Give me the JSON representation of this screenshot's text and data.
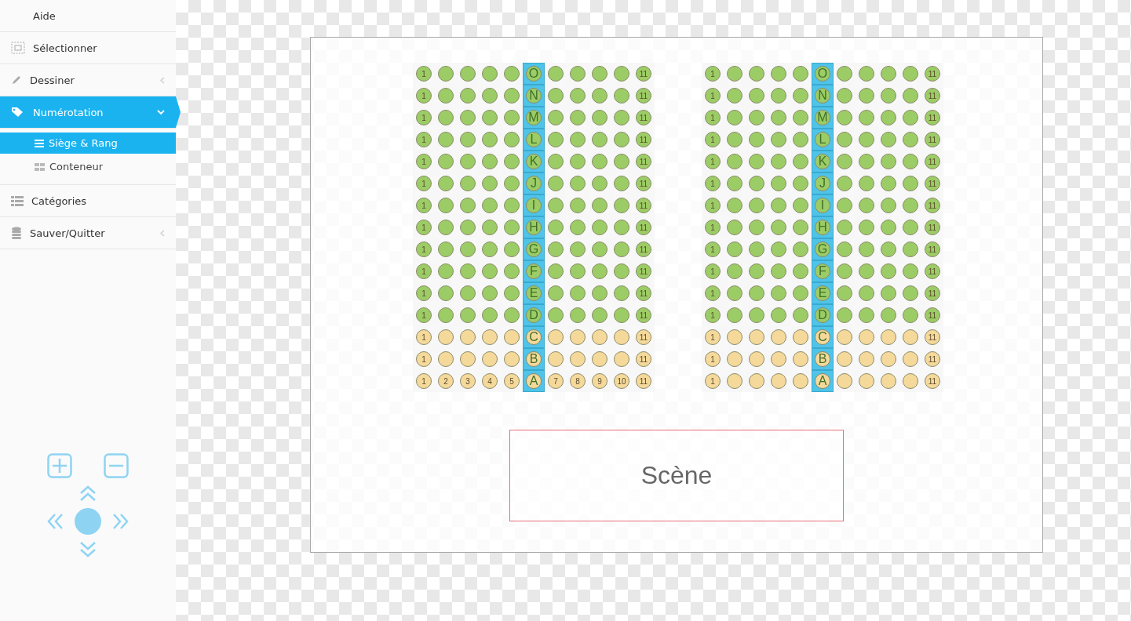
{
  "sidebar": {
    "items": [
      {
        "label": "Aide",
        "selected": false
      },
      {
        "label": "Sélectionner",
        "selected": false
      },
      {
        "label": "Dessiner",
        "selected": false,
        "expanded": false
      },
      {
        "label": "Numérotation",
        "selected": true,
        "expanded": true,
        "children": [
          {
            "label": "Siège & Rang",
            "selected": true
          },
          {
            "label": "Conteneur",
            "selected": false
          }
        ]
      },
      {
        "label": "Catégories",
        "selected": false
      },
      {
        "label": "Sauver/Quitter",
        "selected": false,
        "expanded": false
      }
    ]
  },
  "blocks": [
    {
      "rows": [
        {
          "color": "#9ccc65",
          "seats": [
            {
              "kind": "number",
              "label": "1"
            },
            {
              "kind": "blank"
            },
            {
              "kind": "blank"
            },
            {
              "kind": "blank"
            },
            {
              "kind": "blank"
            },
            {
              "kind": "row",
              "label": "O"
            },
            {
              "kind": "blank"
            },
            {
              "kind": "blank"
            },
            {
              "kind": "blank"
            },
            {
              "kind": "blank"
            },
            {
              "kind": "number",
              "label": "11"
            }
          ]
        },
        {
          "color": "#9ccc65",
          "seats": [
            {
              "kind": "number",
              "label": "1"
            },
            {
              "kind": "blank"
            },
            {
              "kind": "blank"
            },
            {
              "kind": "blank"
            },
            {
              "kind": "blank"
            },
            {
              "kind": "row",
              "label": "N"
            },
            {
              "kind": "blank"
            },
            {
              "kind": "blank"
            },
            {
              "kind": "blank"
            },
            {
              "kind": "blank"
            },
            {
              "kind": "number",
              "label": "11"
            }
          ]
        },
        {
          "color": "#9ccc65",
          "seats": [
            {
              "kind": "number",
              "label": "1"
            },
            {
              "kind": "blank"
            },
            {
              "kind": "blank"
            },
            {
              "kind": "blank"
            },
            {
              "kind": "blank"
            },
            {
              "kind": "row",
              "label": "M"
            },
            {
              "kind": "blank"
            },
            {
              "kind": "blank"
            },
            {
              "kind": "blank"
            },
            {
              "kind": "blank"
            },
            {
              "kind": "number",
              "label": "11"
            }
          ]
        },
        {
          "color": "#9ccc65",
          "seats": [
            {
              "kind": "number",
              "label": "1"
            },
            {
              "kind": "blank"
            },
            {
              "kind": "blank"
            },
            {
              "kind": "blank"
            },
            {
              "kind": "blank"
            },
            {
              "kind": "row",
              "label": "L"
            },
            {
              "kind": "blank"
            },
            {
              "kind": "blank"
            },
            {
              "kind": "blank"
            },
            {
              "kind": "blank"
            },
            {
              "kind": "number",
              "label": "11"
            }
          ]
        },
        {
          "color": "#9ccc65",
          "seats": [
            {
              "kind": "number",
              "label": "1"
            },
            {
              "kind": "blank"
            },
            {
              "kind": "blank"
            },
            {
              "kind": "blank"
            },
            {
              "kind": "blank"
            },
            {
              "kind": "row",
              "label": "K"
            },
            {
              "kind": "blank"
            },
            {
              "kind": "blank"
            },
            {
              "kind": "blank"
            },
            {
              "kind": "blank"
            },
            {
              "kind": "number",
              "label": "11"
            }
          ]
        },
        {
          "color": "#9ccc65",
          "seats": [
            {
              "kind": "number",
              "label": "1"
            },
            {
              "kind": "blank"
            },
            {
              "kind": "blank"
            },
            {
              "kind": "blank"
            },
            {
              "kind": "blank"
            },
            {
              "kind": "row",
              "label": "J"
            },
            {
              "kind": "blank"
            },
            {
              "kind": "blank"
            },
            {
              "kind": "blank"
            },
            {
              "kind": "blank"
            },
            {
              "kind": "number",
              "label": "11"
            }
          ]
        },
        {
          "color": "#9ccc65",
          "seats": [
            {
              "kind": "number",
              "label": "1"
            },
            {
              "kind": "blank"
            },
            {
              "kind": "blank"
            },
            {
              "kind": "blank"
            },
            {
              "kind": "blank"
            },
            {
              "kind": "row",
              "label": "I"
            },
            {
              "kind": "blank"
            },
            {
              "kind": "blank"
            },
            {
              "kind": "blank"
            },
            {
              "kind": "blank"
            },
            {
              "kind": "number",
              "label": "11"
            }
          ]
        },
        {
          "color": "#9ccc65",
          "seats": [
            {
              "kind": "number",
              "label": "1"
            },
            {
              "kind": "blank"
            },
            {
              "kind": "blank"
            },
            {
              "kind": "blank"
            },
            {
              "kind": "blank"
            },
            {
              "kind": "row",
              "label": "H"
            },
            {
              "kind": "blank"
            },
            {
              "kind": "blank"
            },
            {
              "kind": "blank"
            },
            {
              "kind": "blank"
            },
            {
              "kind": "number",
              "label": "11"
            }
          ]
        },
        {
          "color": "#9ccc65",
          "seats": [
            {
              "kind": "number",
              "label": "1"
            },
            {
              "kind": "blank"
            },
            {
              "kind": "blank"
            },
            {
              "kind": "blank"
            },
            {
              "kind": "blank"
            },
            {
              "kind": "row",
              "label": "G"
            },
            {
              "kind": "blank"
            },
            {
              "kind": "blank"
            },
            {
              "kind": "blank"
            },
            {
              "kind": "blank"
            },
            {
              "kind": "number",
              "label": "11"
            }
          ]
        },
        {
          "color": "#9ccc65",
          "seats": [
            {
              "kind": "number",
              "label": "1"
            },
            {
              "kind": "blank"
            },
            {
              "kind": "blank"
            },
            {
              "kind": "blank"
            },
            {
              "kind": "blank"
            },
            {
              "kind": "row",
              "label": "F"
            },
            {
              "kind": "blank"
            },
            {
              "kind": "blank"
            },
            {
              "kind": "blank"
            },
            {
              "kind": "blank"
            },
            {
              "kind": "number",
              "label": "11"
            }
          ]
        },
        {
          "color": "#9ccc65",
          "seats": [
            {
              "kind": "number",
              "label": "1"
            },
            {
              "kind": "blank"
            },
            {
              "kind": "blank"
            },
            {
              "kind": "blank"
            },
            {
              "kind": "blank"
            },
            {
              "kind": "row",
              "label": "E"
            },
            {
              "kind": "blank"
            },
            {
              "kind": "blank"
            },
            {
              "kind": "blank"
            },
            {
              "kind": "blank"
            },
            {
              "kind": "number",
              "label": "11"
            }
          ]
        },
        {
          "color": "#9ccc65",
          "seats": [
            {
              "kind": "number",
              "label": "1"
            },
            {
              "kind": "blank"
            },
            {
              "kind": "blank"
            },
            {
              "kind": "blank"
            },
            {
              "kind": "blank"
            },
            {
              "kind": "row",
              "label": "D"
            },
            {
              "kind": "blank"
            },
            {
              "kind": "blank"
            },
            {
              "kind": "blank"
            },
            {
              "kind": "blank"
            },
            {
              "kind": "number",
              "label": "11"
            }
          ]
        },
        {
          "color": "#f5d99a",
          "seats": [
            {
              "kind": "number",
              "label": "1"
            },
            {
              "kind": "blank"
            },
            {
              "kind": "blank"
            },
            {
              "kind": "blank"
            },
            {
              "kind": "blank"
            },
            {
              "kind": "row",
              "label": "C"
            },
            {
              "kind": "blank"
            },
            {
              "kind": "blank"
            },
            {
              "kind": "blank"
            },
            {
              "kind": "blank"
            },
            {
              "kind": "number",
              "label": "11"
            }
          ]
        },
        {
          "color": "#f5d99a",
          "seats": [
            {
              "kind": "number",
              "label": "1"
            },
            {
              "kind": "blank"
            },
            {
              "kind": "blank"
            },
            {
              "kind": "blank"
            },
            {
              "kind": "blank"
            },
            {
              "kind": "row",
              "label": "B"
            },
            {
              "kind": "blank"
            },
            {
              "kind": "blank"
            },
            {
              "kind": "blank"
            },
            {
              "kind": "blank"
            },
            {
              "kind": "number",
              "label": "11"
            }
          ]
        },
        {
          "color": "#f5d99a",
          "seats": [
            {
              "kind": "number",
              "label": "1"
            },
            {
              "kind": "number",
              "label": "2"
            },
            {
              "kind": "number",
              "label": "3"
            },
            {
              "kind": "number",
              "label": "4"
            },
            {
              "kind": "number",
              "label": "5"
            },
            {
              "kind": "row",
              "label": "A"
            },
            {
              "kind": "number",
              "label": "7"
            },
            {
              "kind": "number",
              "label": "8"
            },
            {
              "kind": "number",
              "label": "9"
            },
            {
              "kind": "number",
              "label": "10"
            },
            {
              "kind": "number",
              "label": "11"
            }
          ]
        }
      ]
    },
    {
      "rows": [
        {
          "color": "#9ccc65",
          "seats": [
            {
              "kind": "number",
              "label": "1"
            },
            {
              "kind": "blank"
            },
            {
              "kind": "blank"
            },
            {
              "kind": "blank"
            },
            {
              "kind": "blank"
            },
            {
              "kind": "row",
              "label": "O"
            },
            {
              "kind": "blank"
            },
            {
              "kind": "blank"
            },
            {
              "kind": "blank"
            },
            {
              "kind": "blank"
            },
            {
              "kind": "number",
              "label": "11"
            }
          ]
        },
        {
          "color": "#9ccc65",
          "seats": [
            {
              "kind": "number",
              "label": "1"
            },
            {
              "kind": "blank"
            },
            {
              "kind": "blank"
            },
            {
              "kind": "blank"
            },
            {
              "kind": "blank"
            },
            {
              "kind": "row",
              "label": "N"
            },
            {
              "kind": "blank"
            },
            {
              "kind": "blank"
            },
            {
              "kind": "blank"
            },
            {
              "kind": "blank"
            },
            {
              "kind": "number",
              "label": "11"
            }
          ]
        },
        {
          "color": "#9ccc65",
          "seats": [
            {
              "kind": "number",
              "label": "1"
            },
            {
              "kind": "blank"
            },
            {
              "kind": "blank"
            },
            {
              "kind": "blank"
            },
            {
              "kind": "blank"
            },
            {
              "kind": "row",
              "label": "M"
            },
            {
              "kind": "blank"
            },
            {
              "kind": "blank"
            },
            {
              "kind": "blank"
            },
            {
              "kind": "blank"
            },
            {
              "kind": "number",
              "label": "11"
            }
          ]
        },
        {
          "color": "#9ccc65",
          "seats": [
            {
              "kind": "number",
              "label": "1"
            },
            {
              "kind": "blank"
            },
            {
              "kind": "blank"
            },
            {
              "kind": "blank"
            },
            {
              "kind": "blank"
            },
            {
              "kind": "row",
              "label": "L"
            },
            {
              "kind": "blank"
            },
            {
              "kind": "blank"
            },
            {
              "kind": "blank"
            },
            {
              "kind": "blank"
            },
            {
              "kind": "number",
              "label": "11"
            }
          ]
        },
        {
          "color": "#9ccc65",
          "seats": [
            {
              "kind": "number",
              "label": "1"
            },
            {
              "kind": "blank"
            },
            {
              "kind": "blank"
            },
            {
              "kind": "blank"
            },
            {
              "kind": "blank"
            },
            {
              "kind": "row",
              "label": "K"
            },
            {
              "kind": "blank"
            },
            {
              "kind": "blank"
            },
            {
              "kind": "blank"
            },
            {
              "kind": "blank"
            },
            {
              "kind": "number",
              "label": "11"
            }
          ]
        },
        {
          "color": "#9ccc65",
          "seats": [
            {
              "kind": "number",
              "label": "1"
            },
            {
              "kind": "blank"
            },
            {
              "kind": "blank"
            },
            {
              "kind": "blank"
            },
            {
              "kind": "blank"
            },
            {
              "kind": "row",
              "label": "J"
            },
            {
              "kind": "blank"
            },
            {
              "kind": "blank"
            },
            {
              "kind": "blank"
            },
            {
              "kind": "blank"
            },
            {
              "kind": "number",
              "label": "11"
            }
          ]
        },
        {
          "color": "#9ccc65",
          "seats": [
            {
              "kind": "number",
              "label": "1"
            },
            {
              "kind": "blank"
            },
            {
              "kind": "blank"
            },
            {
              "kind": "blank"
            },
            {
              "kind": "blank"
            },
            {
              "kind": "row",
              "label": "I"
            },
            {
              "kind": "blank"
            },
            {
              "kind": "blank"
            },
            {
              "kind": "blank"
            },
            {
              "kind": "blank"
            },
            {
              "kind": "number",
              "label": "11"
            }
          ]
        },
        {
          "color": "#9ccc65",
          "seats": [
            {
              "kind": "number",
              "label": "1"
            },
            {
              "kind": "blank"
            },
            {
              "kind": "blank"
            },
            {
              "kind": "blank"
            },
            {
              "kind": "blank"
            },
            {
              "kind": "row",
              "label": "H"
            },
            {
              "kind": "blank"
            },
            {
              "kind": "blank"
            },
            {
              "kind": "blank"
            },
            {
              "kind": "blank"
            },
            {
              "kind": "number",
              "label": "11"
            }
          ]
        },
        {
          "color": "#9ccc65",
          "seats": [
            {
              "kind": "number",
              "label": "1"
            },
            {
              "kind": "blank"
            },
            {
              "kind": "blank"
            },
            {
              "kind": "blank"
            },
            {
              "kind": "blank"
            },
            {
              "kind": "row",
              "label": "G"
            },
            {
              "kind": "blank"
            },
            {
              "kind": "blank"
            },
            {
              "kind": "blank"
            },
            {
              "kind": "blank"
            },
            {
              "kind": "number",
              "label": "11"
            }
          ]
        },
        {
          "color": "#9ccc65",
          "seats": [
            {
              "kind": "number",
              "label": "1"
            },
            {
              "kind": "blank"
            },
            {
              "kind": "blank"
            },
            {
              "kind": "blank"
            },
            {
              "kind": "blank"
            },
            {
              "kind": "row",
              "label": "F"
            },
            {
              "kind": "blank"
            },
            {
              "kind": "blank"
            },
            {
              "kind": "blank"
            },
            {
              "kind": "blank"
            },
            {
              "kind": "number",
              "label": "11"
            }
          ]
        },
        {
          "color": "#9ccc65",
          "seats": [
            {
              "kind": "number",
              "label": "1"
            },
            {
              "kind": "blank"
            },
            {
              "kind": "blank"
            },
            {
              "kind": "blank"
            },
            {
              "kind": "blank"
            },
            {
              "kind": "row",
              "label": "E"
            },
            {
              "kind": "blank"
            },
            {
              "kind": "blank"
            },
            {
              "kind": "blank"
            },
            {
              "kind": "blank"
            },
            {
              "kind": "number",
              "label": "11"
            }
          ]
        },
        {
          "color": "#9ccc65",
          "seats": [
            {
              "kind": "number",
              "label": "1"
            },
            {
              "kind": "blank"
            },
            {
              "kind": "blank"
            },
            {
              "kind": "blank"
            },
            {
              "kind": "blank"
            },
            {
              "kind": "row",
              "label": "D"
            },
            {
              "kind": "blank"
            },
            {
              "kind": "blank"
            },
            {
              "kind": "blank"
            },
            {
              "kind": "blank"
            },
            {
              "kind": "number",
              "label": "11"
            }
          ]
        },
        {
          "color": "#f5d99a",
          "seats": [
            {
              "kind": "number",
              "label": "1"
            },
            {
              "kind": "blank"
            },
            {
              "kind": "blank"
            },
            {
              "kind": "blank"
            },
            {
              "kind": "blank"
            },
            {
              "kind": "row",
              "label": "C"
            },
            {
              "kind": "blank"
            },
            {
              "kind": "blank"
            },
            {
              "kind": "blank"
            },
            {
              "kind": "blank"
            },
            {
              "kind": "number",
              "label": "11"
            }
          ]
        },
        {
          "color": "#f5d99a",
          "seats": [
            {
              "kind": "number",
              "label": "1"
            },
            {
              "kind": "blank"
            },
            {
              "kind": "blank"
            },
            {
              "kind": "blank"
            },
            {
              "kind": "blank"
            },
            {
              "kind": "row",
              "label": "B"
            },
            {
              "kind": "blank"
            },
            {
              "kind": "blank"
            },
            {
              "kind": "blank"
            },
            {
              "kind": "blank"
            },
            {
              "kind": "number",
              "label": "11"
            }
          ]
        },
        {
          "color": "#f5d99a",
          "seats": [
            {
              "kind": "number",
              "label": "1"
            },
            {
              "kind": "blank"
            },
            {
              "kind": "blank"
            },
            {
              "kind": "blank"
            },
            {
              "kind": "blank"
            },
            {
              "kind": "row",
              "label": "A"
            },
            {
              "kind": "blank"
            },
            {
              "kind": "blank"
            },
            {
              "kind": "blank"
            },
            {
              "kind": "blank"
            },
            {
              "kind": "number",
              "label": "11"
            }
          ]
        }
      ]
    }
  ],
  "stage": {
    "label": "Scène"
  }
}
